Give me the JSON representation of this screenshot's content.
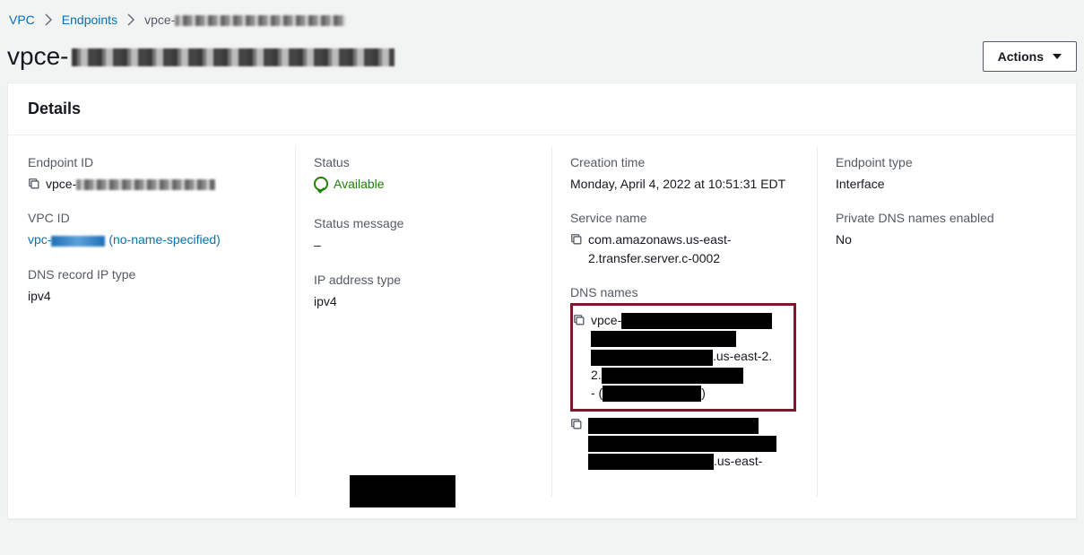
{
  "breadcrumb": {
    "vpc": "VPC",
    "endpoints": "Endpoints",
    "current_prefix": "vpce-"
  },
  "title_prefix": "vpce-",
  "actions": {
    "label": "Actions"
  },
  "panel": {
    "title": "Details"
  },
  "col1": {
    "endpoint_id_label": "Endpoint ID",
    "endpoint_id_prefix": "vpce-",
    "vpc_id_label": "VPC ID",
    "vpc_id_prefix": "vpc-",
    "vpc_id_suffix": " (no-name-specified)",
    "dns_record_ip_type_label": "DNS record IP type",
    "dns_record_ip_type_value": "ipv4"
  },
  "col2": {
    "status_label": "Status",
    "status_value": "Available",
    "status_message_label": "Status message",
    "status_message_value": "–",
    "ip_address_type_label": "IP address type",
    "ip_address_type_value": "ipv4"
  },
  "col3": {
    "creation_time_label": "Creation time",
    "creation_time_value": "Monday, April 4, 2022 at 10:51:31 EDT",
    "service_name_label": "Service name",
    "service_name_value": "com.amazonaws.us-east-2.transfer.server.c-0002",
    "dns_names_label": "DNS names",
    "dns1_prefix": "vpce-",
    "dns1_mid": ".us-east-2.",
    "dns1_dash": "- (",
    "dns1_close": ")",
    "dns2_suffix": ".us-east-"
  },
  "col4": {
    "endpoint_type_label": "Endpoint type",
    "endpoint_type_value": "Interface",
    "private_dns_label": "Private DNS names enabled",
    "private_dns_value": "No"
  }
}
